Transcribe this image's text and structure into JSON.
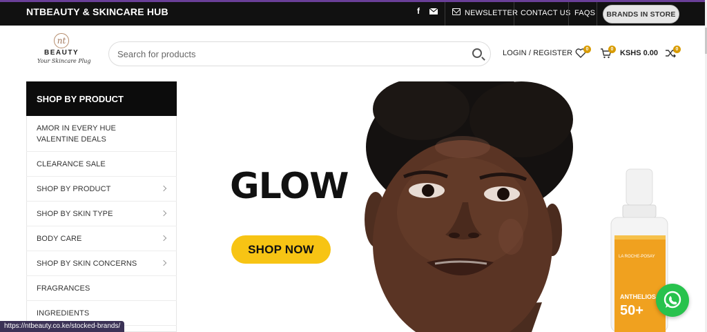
{
  "topbar": {
    "brand": "NTBEAUTY & SKINCARE HUB",
    "social": [
      "facebook-icon",
      "mail-icon"
    ],
    "links": {
      "newsletter": "NEWSLETTER",
      "contact": "CONTACT US",
      "faqs": "FAQS"
    },
    "brands_button": "BRANDS IN STORE",
    "accent_color": "#6a3f98"
  },
  "logo": {
    "mark": "nt",
    "wordmark": "BEAUTY",
    "tagline": "Your Skincare Plug"
  },
  "search": {
    "placeholder": "Search for products"
  },
  "header": {
    "login": "LOGIN / REGISTER",
    "wishlist_count": "0",
    "cart_count": "0",
    "cart_total": "KSHS 0.00",
    "compare_count": "0"
  },
  "sidebar": {
    "title": "SHOP BY PRODUCT",
    "items": [
      {
        "label": "AMOR IN EVERY HUE VALENTINE DEALS",
        "has_arrow": false
      },
      {
        "label": "CLEARANCE SALE",
        "has_arrow": false
      },
      {
        "label": "SHOP BY PRODUCT",
        "has_arrow": true
      },
      {
        "label": "SHOP BY SKIN TYPE",
        "has_arrow": true
      },
      {
        "label": "BODY CARE",
        "has_arrow": true
      },
      {
        "label": "SHOP BY SKIN CONCERNS",
        "has_arrow": true
      },
      {
        "label": "FRAGRANCES",
        "has_arrow": false
      },
      {
        "label": "INGREDIENTS",
        "has_arrow": false
      }
    ]
  },
  "hero": {
    "title": "GLOW",
    "cta": "SHOP NOW",
    "cta_color": "#f7c414",
    "product": {
      "brand": "LA ROCHE-POSAY",
      "name": "ANTHELIOS",
      "spf": "50+"
    }
  },
  "status_url": "https://ntbeauty.co.ke/stocked-brands/",
  "whatsapp": {
    "color": "#28c24d"
  }
}
